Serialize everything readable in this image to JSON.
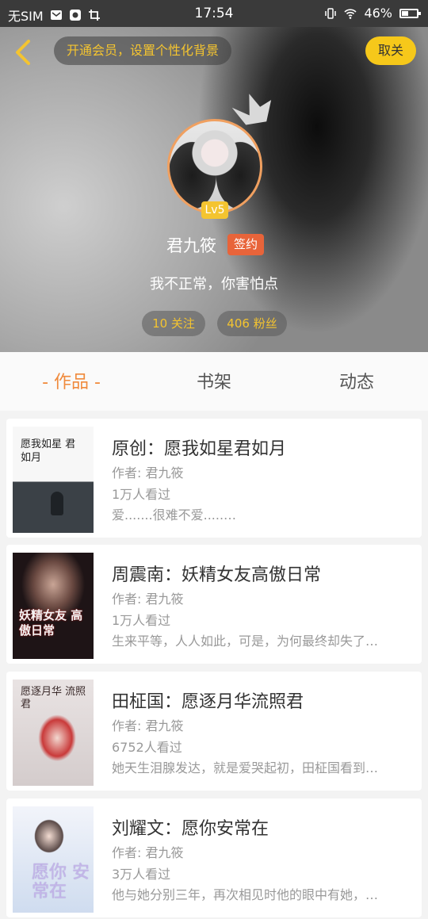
{
  "status_bar": {
    "carrier": "无SIM",
    "time": "17:54",
    "battery": "46%",
    "battery_fraction": 0.46
  },
  "header": {
    "vip_banner": "开通会员，设置个性化背景",
    "follow_button": "取关",
    "level": "Lv5",
    "username": "君九筱",
    "badge": "签约",
    "bio": "我不正常，你害怕点",
    "following": "10 关注",
    "followers": "406 粉丝"
  },
  "tabs": [
    {
      "label": "- 作品 -",
      "active": true
    },
    {
      "label": "书架",
      "active": false
    },
    {
      "label": "动态",
      "active": false
    }
  ],
  "works": [
    {
      "title": "原创：愿我如星君如月",
      "author": "作者: 君九筱",
      "views": "1万人看过",
      "desc": "爱.......很难不爱.....…",
      "cover_text": "愿我如星 君如月"
    },
    {
      "title": "周震南：妖精女友高傲日常",
      "author": "作者: 君九筱",
      "views": "1万人看过",
      "desc": "生来平等，人人如此，可是，为何最终却失了…",
      "cover_text": "妖精女友 高傲日常"
    },
    {
      "title": "田柾国：愿逐月华流照君",
      "author": "作者: 君九筱",
      "views": "6752人看过",
      "desc": "她天生泪腺发达，就是爱哭起初，田柾国看到…",
      "cover_text": "愿逐月华 流照君"
    },
    {
      "title": "刘耀文：愿你安常在",
      "author": "作者: 君九筱",
      "views": "3万人看过",
      "desc": "他与她分别三年，再次相见时他的眼中有她，…",
      "cover_text": "愿你 安常在"
    }
  ]
}
